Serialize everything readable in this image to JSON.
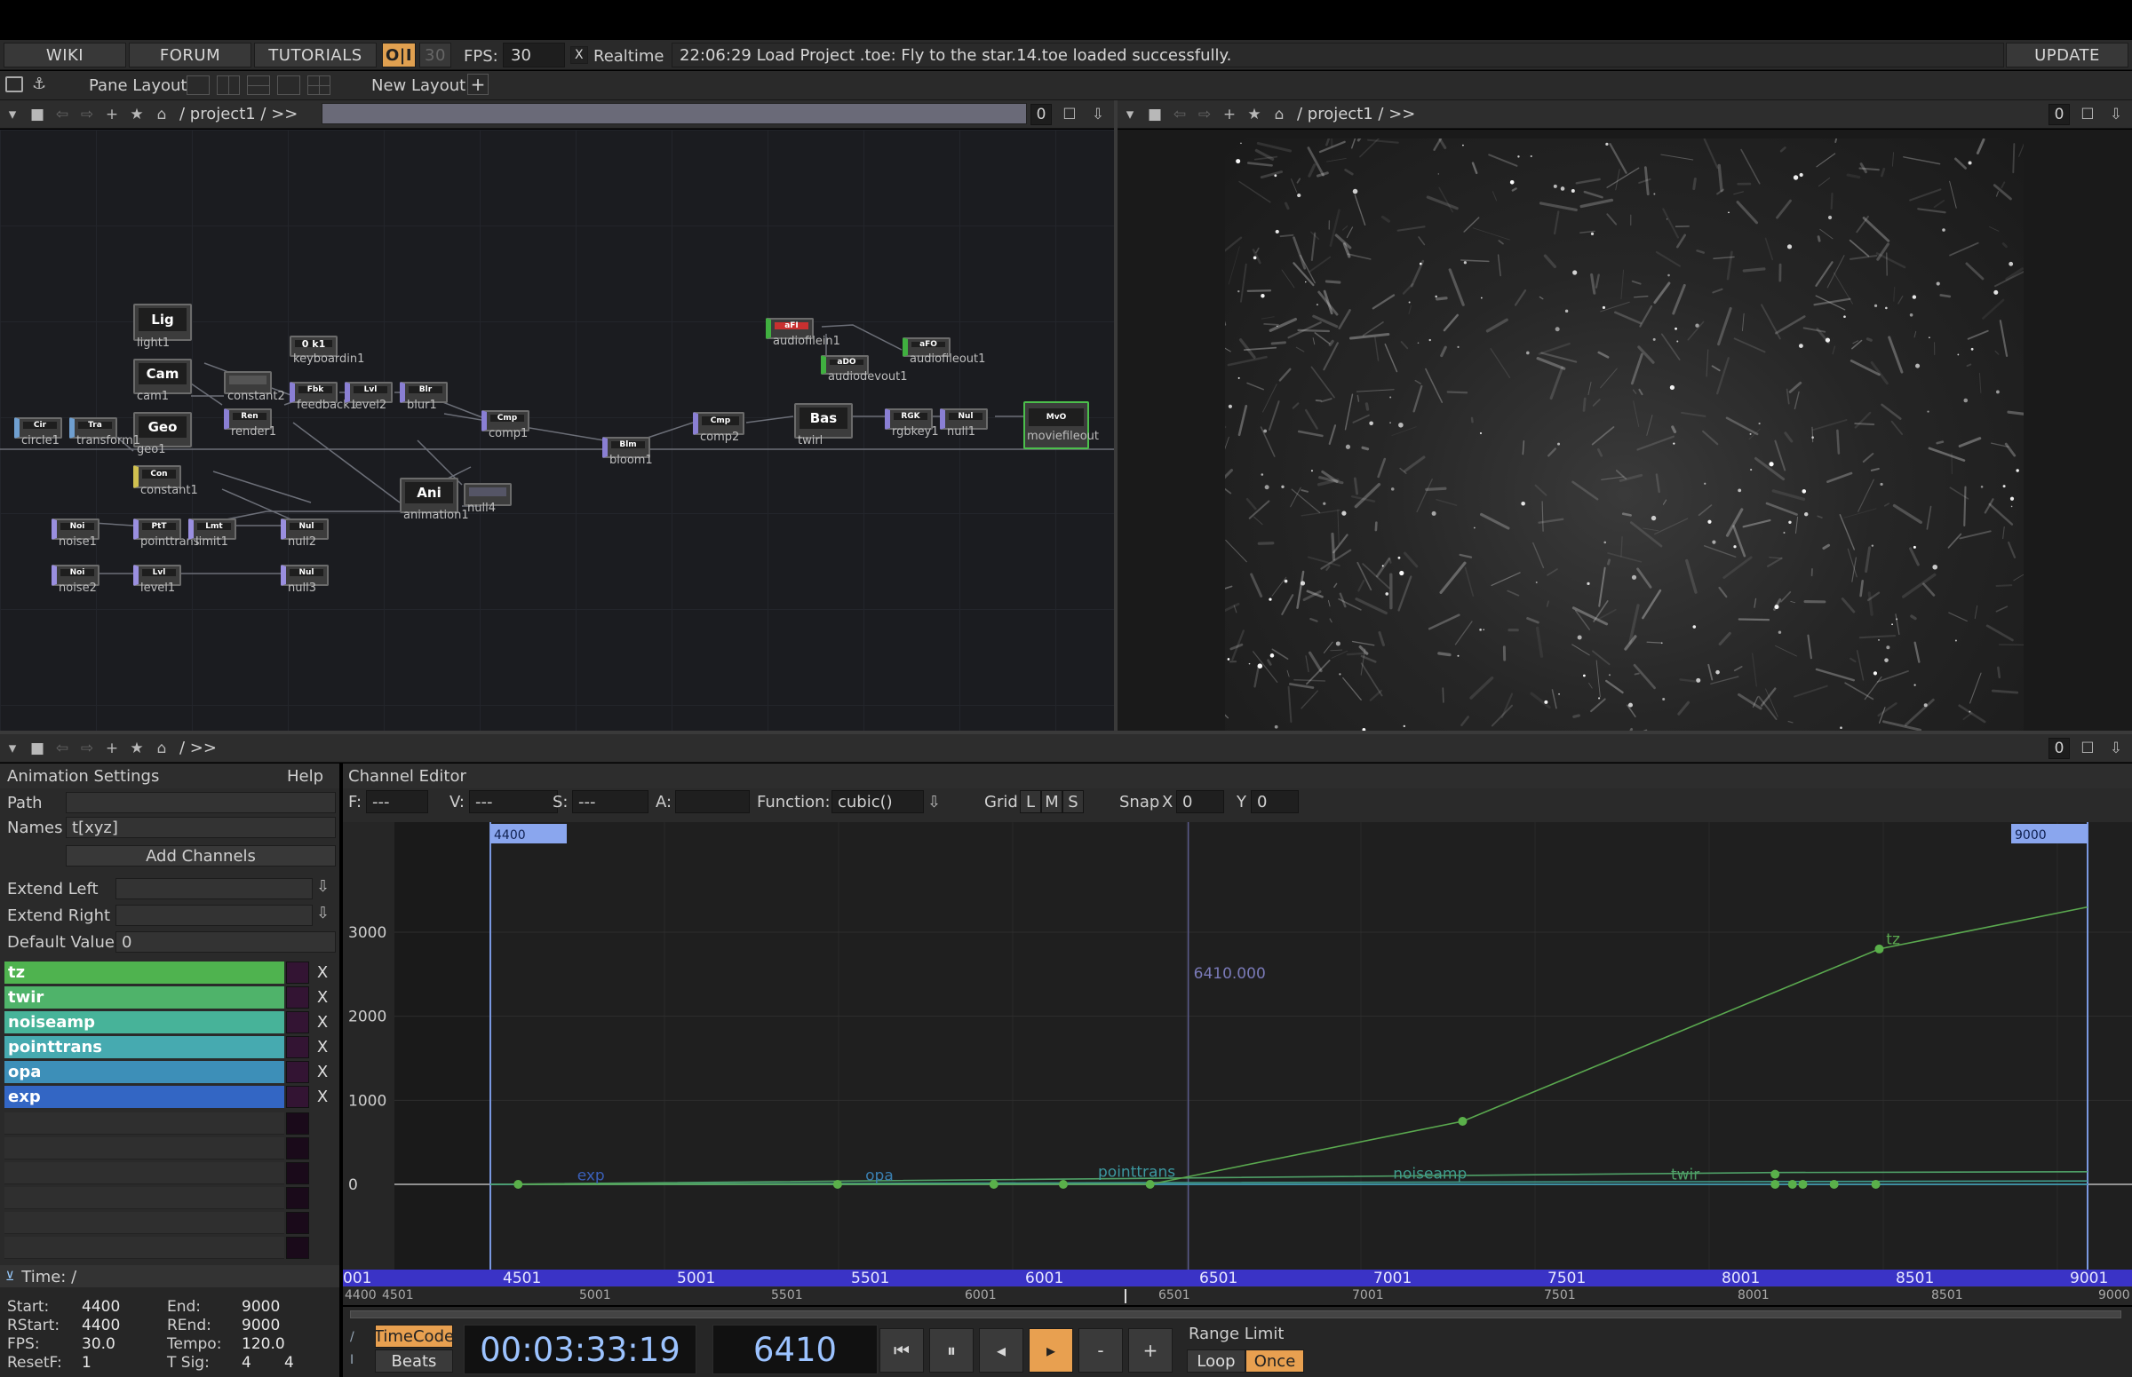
{
  "topbar": {
    "wiki": "WIKI",
    "forum": "FORUM",
    "tutorials": "TUTORIALS",
    "oi": "O|I",
    "fps_dim": "30",
    "fps_label": "FPS:",
    "fps_value": "30",
    "realtime_check": "X",
    "realtime": "Realtime",
    "status": "22:06:29 Load Project .toe: Fly to the star.14.toe loaded successfully.",
    "update": "UPDATE"
  },
  "panebar": {
    "pane_layout": "Pane Layout",
    "new_layout": "New Layout",
    "plus": "+"
  },
  "left_pane": {
    "path": "/ project1 / >>",
    "num": "0"
  },
  "right_pane": {
    "path": "/ project1 / >>",
    "num": "0"
  },
  "bottom_pane": {
    "path": "/ >>",
    "num": "0"
  },
  "network": {
    "nodes": [
      {
        "id": "light1",
        "icon": "Lig",
        "label": "light1"
      },
      {
        "id": "cam1",
        "icon": "Cam",
        "label": "cam1"
      },
      {
        "id": "geo1",
        "icon": "Geo",
        "label": "geo1"
      },
      {
        "id": "constant1",
        "icon": "Con",
        "label": "constant1"
      },
      {
        "id": "keyboardin1",
        "icon": "0 k1",
        "label": "keyboardin1"
      },
      {
        "id": "constant2",
        "icon": "",
        "label": "constant2"
      },
      {
        "id": "render1",
        "icon": "Ren",
        "label": "render1"
      },
      {
        "id": "feedback1",
        "icon": "Fbk",
        "label": "feedback1"
      },
      {
        "id": "level2",
        "icon": "Lvl",
        "label": "level2"
      },
      {
        "id": "blur1",
        "icon": "Blr",
        "label": "blur1"
      },
      {
        "id": "comp1",
        "icon": "Cmp",
        "label": "comp1"
      },
      {
        "id": "bloom1",
        "icon": "Blm",
        "label": "bloom1"
      },
      {
        "id": "comp2",
        "icon": "Cmp",
        "label": "comp2"
      },
      {
        "id": "twirl",
        "icon": "Bas",
        "label": "twirl"
      },
      {
        "id": "rgbkey1",
        "icon": "RGK",
        "label": "rgbkey1"
      },
      {
        "id": "null1",
        "icon": "Nul",
        "label": "null1"
      },
      {
        "id": "moviefileout",
        "icon": "MvO",
        "label": "moviefileout"
      },
      {
        "id": "audiofilein1",
        "icon": "aFI",
        "label": "audiofilein1"
      },
      {
        "id": "audiodevout1",
        "icon": "aDO",
        "label": "audiodevout1"
      },
      {
        "id": "audiofileout1",
        "icon": "aFO",
        "label": "audiofileout1"
      },
      {
        "id": "circle1",
        "icon": "Cir",
        "label": "circle1"
      },
      {
        "id": "transform1",
        "icon": "Tra",
        "label": "transform1"
      },
      {
        "id": "animation1",
        "icon": "Ani",
        "label": "animation1"
      },
      {
        "id": "null4",
        "icon": "",
        "label": "null4"
      },
      {
        "id": "noise1",
        "icon": "Noi",
        "label": "noise1"
      },
      {
        "id": "pointtrans",
        "icon": "PtT",
        "label": "pointtrans"
      },
      {
        "id": "limit1",
        "icon": "Lmt",
        "label": "limit1"
      },
      {
        "id": "null2",
        "icon": "Nul",
        "label": "null2"
      },
      {
        "id": "noise2",
        "icon": "Noi",
        "label": "noise2"
      },
      {
        "id": "level1",
        "icon": "Lvl",
        "label": "level1"
      },
      {
        "id": "null3",
        "icon": "Nul",
        "label": "null3"
      }
    ]
  },
  "anim_settings": {
    "title": "Animation Settings",
    "help": "Help",
    "path_label": "Path",
    "path_value": "",
    "names_label": "Names",
    "names_value": "t[xyz]",
    "add_channels": "Add Channels",
    "extend_left": "Extend Left",
    "extend_right": "Extend Right",
    "default_value_label": "Default Value",
    "default_value": "0",
    "channels": [
      {
        "name": "tz",
        "color": "#4fb34f"
      },
      {
        "name": "twir",
        "color": "#4fb36a"
      },
      {
        "name": "noiseamp",
        "color": "#47b399"
      },
      {
        "name": "pointtrans",
        "color": "#46aab0"
      },
      {
        "name": "opa",
        "color": "#3d8fb8"
      },
      {
        "name": "exp",
        "color": "#3366c4"
      }
    ],
    "remove": "X"
  },
  "channel_editor": {
    "title": "Channel Editor",
    "f_label": "F:",
    "f_value": "---",
    "v_label": "V:",
    "v_value": "---",
    "s_label": "S:",
    "s_value": "---",
    "a_label": "A:",
    "a_value": "",
    "function_label": "Function:",
    "function_value": "cubic()",
    "grid_label": "Grid",
    "grid_l": "L",
    "grid_m": "M",
    "grid_s": "S",
    "snap_label": "Snap",
    "snap_x_label": "X",
    "snap_x": "0",
    "snap_y_label": "Y",
    "snap_y": "0",
    "range_start_tag": "4400",
    "range_end_tag": "9000",
    "cursor_value": "6410.000",
    "y_ticks": [
      "3000",
      "2000",
      "1000",
      "0"
    ]
  },
  "chart_data": {
    "type": "line",
    "xlim": [
      4400,
      9000
    ],
    "ylim": [
      -300,
      3300
    ],
    "series": [
      {
        "name": "tz",
        "color": "#5aa84f",
        "points": [
          [
            4480,
            0
          ],
          [
            5400,
            0
          ],
          [
            5850,
            0
          ],
          [
            6050,
            0
          ],
          [
            6300,
            0
          ],
          [
            7200,
            750
          ],
          [
            8400,
            2800
          ],
          [
            9000,
            3300
          ]
        ]
      },
      {
        "name": "twir",
        "color": "#4fa067",
        "points": [
          [
            4400,
            0
          ],
          [
            8100,
            140
          ],
          [
            9000,
            150
          ]
        ]
      },
      {
        "name": "noiseamp",
        "color": "#3f9c8c",
        "points": [
          [
            4400,
            0
          ],
          [
            6300,
            20
          ],
          [
            9000,
            40
          ]
        ]
      },
      {
        "name": "pointtrans",
        "color": "#3c98a0",
        "points": [
          [
            4400,
            0
          ],
          [
            9000,
            0
          ]
        ]
      },
      {
        "name": "opa",
        "color": "#3a7fb0",
        "points": [
          [
            4400,
            0
          ],
          [
            9000,
            0
          ]
        ]
      },
      {
        "name": "exp",
        "color": "#3a5fb8",
        "points": [
          [
            4400,
            0
          ],
          [
            9000,
            0
          ]
        ]
      }
    ],
    "labels": [
      {
        "text": "tz",
        "x": 8420,
        "y": 2900
      },
      {
        "text": "exp",
        "x": 4650,
        "y": 90
      },
      {
        "text": "opa",
        "x": 5480,
        "y": 90
      },
      {
        "text": "pointtrans",
        "x": 6150,
        "y": 130
      },
      {
        "text": "noiseamp",
        "x": 7000,
        "y": 110
      },
      {
        "text": "twir",
        "x": 7800,
        "y": 100
      }
    ],
    "key_dots": [
      [
        4480,
        0
      ],
      [
        5400,
        0
      ],
      [
        5850,
        0
      ],
      [
        6050,
        0
      ],
      [
        6300,
        0
      ],
      [
        7200,
        750
      ],
      [
        8400,
        2800
      ],
      [
        8100,
        120
      ],
      [
        8100,
        0
      ],
      [
        8150,
        0
      ],
      [
        8180,
        0
      ],
      [
        8270,
        0
      ],
      [
        8390,
        0
      ]
    ]
  },
  "timeline": {
    "ticks": [
      "001",
      "4501",
      "5001",
      "5501",
      "6001",
      "6501",
      "7001",
      "7501",
      "8001",
      "8501",
      "9001"
    ],
    "ruler_ticks": [
      "4400",
      "4501",
      "5001",
      "5501",
      "6001",
      "6501",
      "7001",
      "7501",
      "8001",
      "8501",
      "9000"
    ],
    "time_label": "Time: /"
  },
  "stats": {
    "start_label": "Start:",
    "start": "4400",
    "end_label": "End:",
    "end": "9000",
    "rstart_label": "RStart:",
    "rstart": "4400",
    "rend_label": "REnd:",
    "rend": "9000",
    "fps_label": "FPS:",
    "fps": "30.0",
    "tempo_label": "Tempo:",
    "tempo": "120.0",
    "resetf_label": "ResetF:",
    "resetf": "1",
    "tsig_label": "T Sig:",
    "tsig_a": "4",
    "tsig_b": "4"
  },
  "transport": {
    "timecode_label": "TimeCode",
    "beats_label": "Beats",
    "timecode": "00:03:33:19",
    "frame": "6410",
    "minus": "-",
    "plus": "+",
    "range_limit": "Range Limit",
    "loop": "Loop",
    "once": "Once"
  },
  "colors": {
    "accent_orange": "#e8a050",
    "timebar": "#3a33c6",
    "tz_green": "#5fbf4a"
  }
}
